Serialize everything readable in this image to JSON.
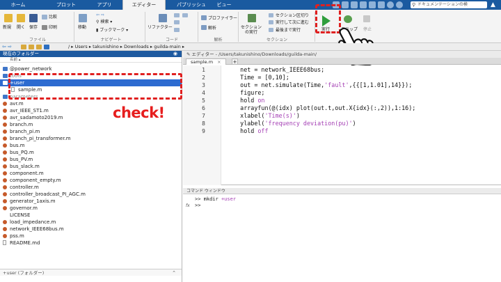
{
  "tabs": [
    {
      "label": "ホーム"
    },
    {
      "label": "プロット"
    },
    {
      "label": "アプリ"
    },
    {
      "label": "エディター",
      "active": true
    },
    {
      "label": "パブリッシュ"
    },
    {
      "label": "ビュー"
    }
  ],
  "search": {
    "placeholder": "ドキュメンテーションの検"
  },
  "ribbon": {
    "file": {
      "new": "新規",
      "open": "開く",
      "save": "保存",
      "compare": "比較",
      "print": "印刷",
      "group": "ファイル"
    },
    "nav": {
      "move": "移動",
      "find": "検索",
      "bookmark": "ブックマーク",
      "group": "ナビゲート"
    },
    "code": {
      "refactor": "リファクター",
      "group": "コード"
    },
    "analyze": {
      "profiler": "プロファイラー",
      "analyze": "解析",
      "group": "解析"
    },
    "section": {
      "run_section": "セクションの実行",
      "section_break": "セクション区切り",
      "run_advance": "実行して次に進む",
      "run_to_end": "最後まで実行",
      "group": "セクション"
    },
    "run": {
      "run": "実行",
      "step": "ステップ",
      "stop": "停止"
    }
  },
  "pathbar": {
    "path": "/ ▸ Users ▸ takunishino ▸ Downloads ▸ guilda-main ▸"
  },
  "current_folder": {
    "title": "現在のフォルダー",
    "column": "名前 ▴",
    "items": [
      {
        "name": "@power_network",
        "icon": "folder-icon",
        "indent": 1
      },
      {
        "name": "tools",
        "icon": "folder-icon",
        "indent": 1,
        "dim": true
      },
      {
        "name": "+user",
        "icon": "folder-icon",
        "indent": 1,
        "selected": true,
        "expanded": true
      },
      {
        "name": "sample.m",
        "icon": "doc-icon",
        "indent": 2
      },
      {
        "name": "parameters",
        "icon": "folder-icon",
        "indent": 1,
        "dim": true
      },
      {
        "name": "avr.m",
        "icon": "mfile-icon",
        "indent": 1
      },
      {
        "name": "avr_IEEE_ST1.m",
        "icon": "mfile-icon",
        "indent": 1
      },
      {
        "name": "avr_sadamoto2019.m",
        "icon": "mfile-icon",
        "indent": 1
      },
      {
        "name": "branch.m",
        "icon": "mfile-icon",
        "indent": 1
      },
      {
        "name": "branch_pi.m",
        "icon": "mfile-icon",
        "indent": 1
      },
      {
        "name": "branch_pi_transformer.m",
        "icon": "mfile-icon",
        "indent": 1
      },
      {
        "name": "bus.m",
        "icon": "mfile-icon",
        "indent": 1
      },
      {
        "name": "bus_PQ.m",
        "icon": "mfile-icon",
        "indent": 1
      },
      {
        "name": "bus_PV.m",
        "icon": "mfile-icon",
        "indent": 1
      },
      {
        "name": "bus_slack.m",
        "icon": "mfile-icon",
        "indent": 1
      },
      {
        "name": "component.m",
        "icon": "mfile-icon",
        "indent": 1
      },
      {
        "name": "component_empty.m",
        "icon": "mfile-icon",
        "indent": 1
      },
      {
        "name": "controller.m",
        "icon": "mfile-icon",
        "indent": 1
      },
      {
        "name": "controller_broadcast_PI_AGC.m",
        "icon": "mfile-icon",
        "indent": 1
      },
      {
        "name": "generator_1axis.m",
        "icon": "mfile-icon",
        "indent": 1
      },
      {
        "name": "governor.m",
        "icon": "mfile-icon",
        "indent": 1
      },
      {
        "name": "LICENSE",
        "icon": "none",
        "indent": 1
      },
      {
        "name": "load_impedance.m",
        "icon": "mfile-icon",
        "indent": 1
      },
      {
        "name": "network_IEEE68bus.m",
        "icon": "mfile-icon",
        "indent": 1
      },
      {
        "name": "pss.m",
        "icon": "mfile-icon",
        "indent": 1
      },
      {
        "name": "README.md",
        "icon": "doc-icon",
        "indent": 1
      }
    ],
    "footer": "+user (フォルダー)"
  },
  "annotation": {
    "check": "check!"
  },
  "editor": {
    "title": "エディター - /Users/takunishino/Downloads/guilda-main/",
    "tab": "sample.m",
    "tab_close": "×",
    "plus": "+",
    "lines": [
      [
        {
          "t": "    net = network_IEEE68bus;"
        }
      ],
      [
        {
          "t": "    Time = [0,10];"
        }
      ],
      [
        {
          "t": "    out = net.simulate(Time,"
        },
        {
          "t": "'fault'",
          "c": "str"
        },
        {
          "t": ",{{[1,1.01],14}});"
        }
      ],
      [
        {
          "t": "    figure;"
        }
      ],
      [
        {
          "t": "    hold "
        },
        {
          "t": "on",
          "c": "str"
        }
      ],
      [
        {
          "t": "    arrayfun(@(idx) plot(out.t,out.X{idx}(:,2)),1:16);"
        }
      ],
      [
        {
          "t": "    xlabel("
        },
        {
          "t": "'Time(s)'",
          "c": "str"
        },
        {
          "t": ")"
        }
      ],
      [
        {
          "t": "    ylabel("
        },
        {
          "t": "'frequency deviation(pu)'",
          "c": "str"
        },
        {
          "t": ")"
        }
      ],
      [
        {
          "t": "    hold "
        },
        {
          "t": "off",
          "c": "str"
        }
      ]
    ],
    "line_numbers": [
      "1",
      "2",
      "3",
      "4",
      "5",
      "6",
      "7",
      "8",
      "9"
    ]
  },
  "command_window": {
    "title": "コマンド ウィンドウ",
    "lines": [
      [
        {
          "t": ">> mkdir "
        },
        {
          "t": "+user",
          "c": "str"
        }
      ],
      [
        {
          "t": ">> "
        }
      ]
    ],
    "fx": "fx"
  }
}
